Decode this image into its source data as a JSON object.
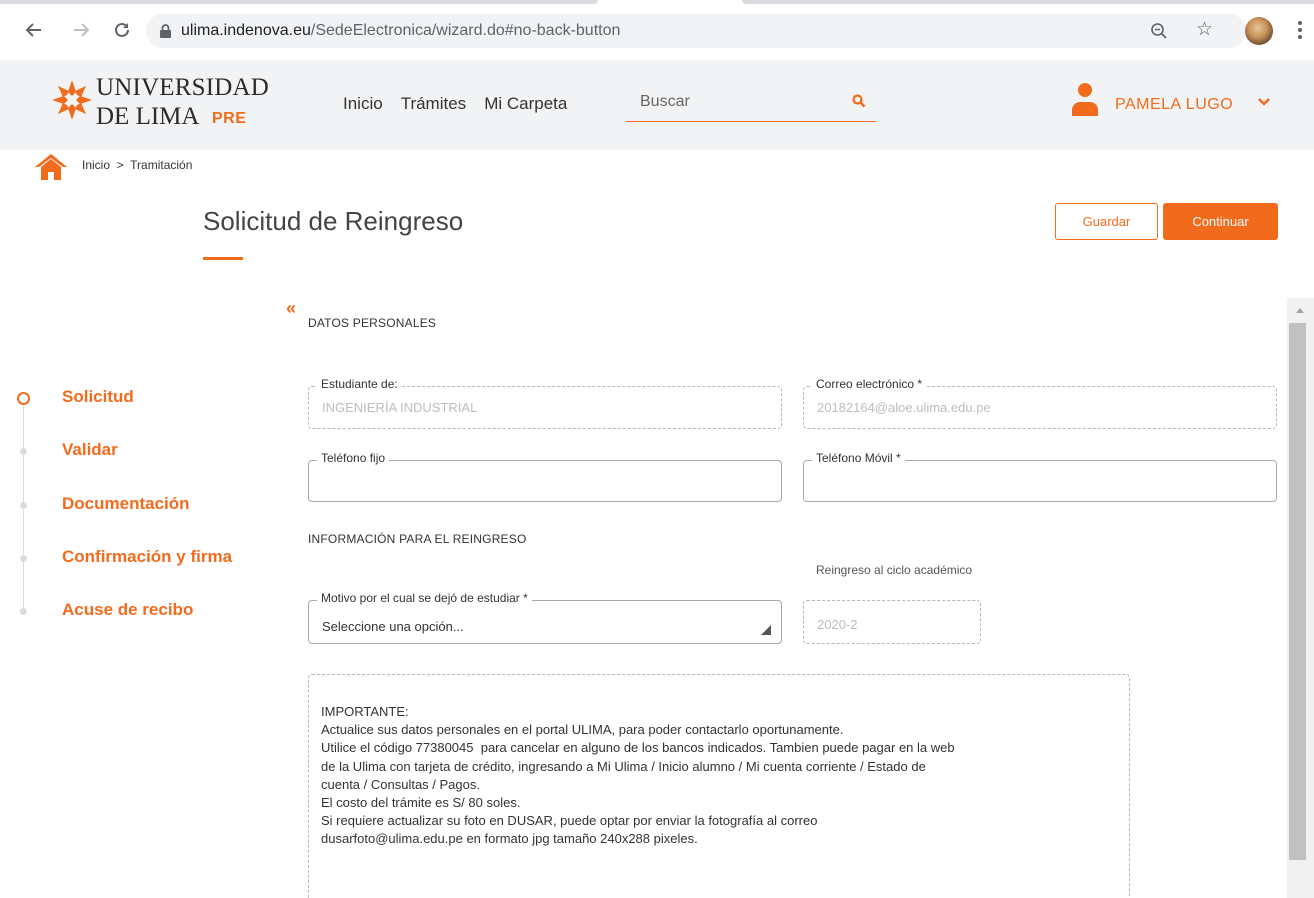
{
  "browser": {
    "url_host": "ulima.indenova.eu",
    "url_path": "/SedeElectronica/wizard.do#no-back-button"
  },
  "header": {
    "logo_line1": "UNIVERSIDAD",
    "logo_line2": "DE LIMA",
    "logo_badge": "PRE",
    "nav": [
      "Inicio",
      "Trámites",
      "Mi Carpeta"
    ],
    "search_placeholder": "Buscar",
    "user_name": "PAMELA LUGO"
  },
  "breadcrumb": "Inicio  >  Tramitación",
  "page": {
    "title": "Solicitud de Reingreso",
    "save_label": "Guardar",
    "continue_label": "Continuar",
    "collapse_glyph": "«"
  },
  "steps": [
    {
      "label": "Solicitud",
      "active": true
    },
    {
      "label": "Validar",
      "active": false
    },
    {
      "label": "Documentación",
      "active": false
    },
    {
      "label": "Confirmación y firma",
      "active": false
    },
    {
      "label": "Acuse de recibo",
      "active": false
    }
  ],
  "form": {
    "section_personal": "DATOS PERSONALES",
    "estudiante_label": "Estudiante de:",
    "estudiante_value": "INGENIERÍA INDUSTRIAL",
    "correo_label": "Correo electrónico *",
    "correo_value": "20182164@aloe.ulima.edu.pe",
    "telefono_fijo_label": "Teléfono fijo",
    "telefono_fijo_value": "",
    "telefono_movil_label": "Teléfono Móvil *",
    "telefono_movil_value": "",
    "section_reingreso": "INFORMACIÓN PARA EL REINGRESO",
    "motivo_label": "Motivo por el cual se dejó de estudiar *",
    "motivo_value": "Seleccione una opción...",
    "reingreso_label": "Reingreso al ciclo académico",
    "reingreso_value": "2020-2"
  },
  "notice": {
    "lines": [
      "IMPORTANTE:",
      "Actualice sus datos personales en el portal ULIMA, para poder contactarlo oportunamente.",
      "Utilice el código 77380045  para cancelar en alguno de los bancos indicados. Tambien puede pagar en la web",
      "de la Ulima con tarjeta de crédito, ingresando a Mi Ulima / Inicio alumno / Mi cuenta corriente / Estado de",
      "cuenta / Consultas / Pagos.",
      "El costo del trámite es S/ 80 soles.",
      "Si requiere actualizar su foto en DUSAR, puede optar por enviar la fotografía al correo",
      "dusarfoto@ulima.edu.pe en formato jpg tamaño 240x288 pixeles."
    ]
  },
  "colors": {
    "accent": "#f26b1d",
    "header_bg": "#f1f3f4"
  }
}
